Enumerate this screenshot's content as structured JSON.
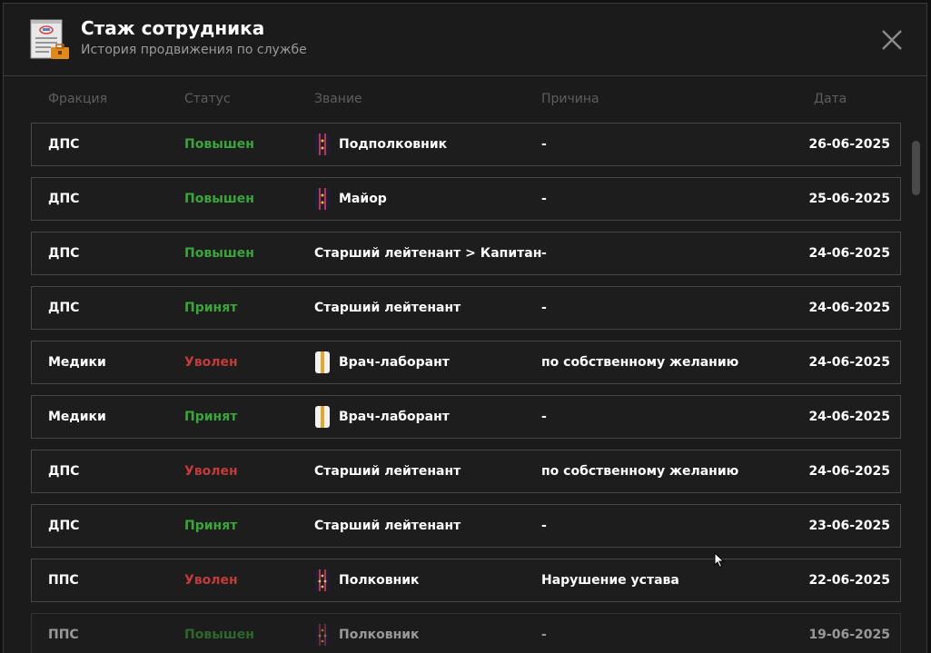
{
  "header": {
    "title": "Стаж сотрудника",
    "subtitle": "История продвижения по службе",
    "icon": "document-briefcase-icon",
    "close_icon": "close-icon"
  },
  "columns": {
    "faction": "Фракция",
    "status": "Статус",
    "rank": "Звание",
    "reason": "Причина",
    "date": "Дата"
  },
  "colors": {
    "promoted": "#3aa53a",
    "fired": "#c33a3a",
    "text": "#ffffff",
    "muted": "#9a9a9a"
  },
  "rows": [
    {
      "faction": "ДПС",
      "status": "Повышен",
      "status_type": "promoted",
      "rank_icon": "epaulette-police",
      "rank": "Подполковник",
      "reason": "-",
      "date": "26-06-2025"
    },
    {
      "faction": "ДПС",
      "status": "Повышен",
      "status_type": "promoted",
      "rank_icon": "epaulette-police",
      "rank": "Майор",
      "reason": "-",
      "date": "25-06-2025"
    },
    {
      "faction": "ДПС",
      "status": "Повышен",
      "status_type": "promoted",
      "rank_icon": "",
      "rank": "Старший лейтенант > Капитан",
      "reason": "-",
      "date": "24-06-2025"
    },
    {
      "faction": "ДПС",
      "status": "Принят",
      "status_type": "hired",
      "rank_icon": "",
      "rank": "Старший лейтенант",
      "reason": "-",
      "date": "24-06-2025"
    },
    {
      "faction": "Медики",
      "status": "Уволен",
      "status_type": "fired",
      "rank_icon": "epaulette-medic",
      "rank": "Врач-лаборант",
      "reason": "по собственному желанию",
      "date": "24-06-2025"
    },
    {
      "faction": "Медики",
      "status": "Принят",
      "status_type": "hired",
      "rank_icon": "epaulette-medic",
      "rank": "Врач-лаборант",
      "reason": "-",
      "date": "24-06-2025"
    },
    {
      "faction": "ДПС",
      "status": "Уволен",
      "status_type": "fired",
      "rank_icon": "",
      "rank": "Старший лейтенант",
      "reason": "по собственному желанию",
      "date": "24-06-2025"
    },
    {
      "faction": "ДПС",
      "status": "Принят",
      "status_type": "hired",
      "rank_icon": "",
      "rank": "Старший лейтенант",
      "reason": "-",
      "date": "23-06-2025"
    },
    {
      "faction": "ППС",
      "status": "Уволен",
      "status_type": "fired",
      "rank_icon": "epaulette-colonel",
      "rank": "Полковник",
      "reason": "Нарушение устава",
      "date": "22-06-2025"
    },
    {
      "faction": "ППС",
      "status": "Повышен",
      "status_type": "promoted",
      "rank_icon": "epaulette-colonel",
      "rank": "Полковник",
      "reason": "-",
      "date": "19-06-2025"
    }
  ]
}
